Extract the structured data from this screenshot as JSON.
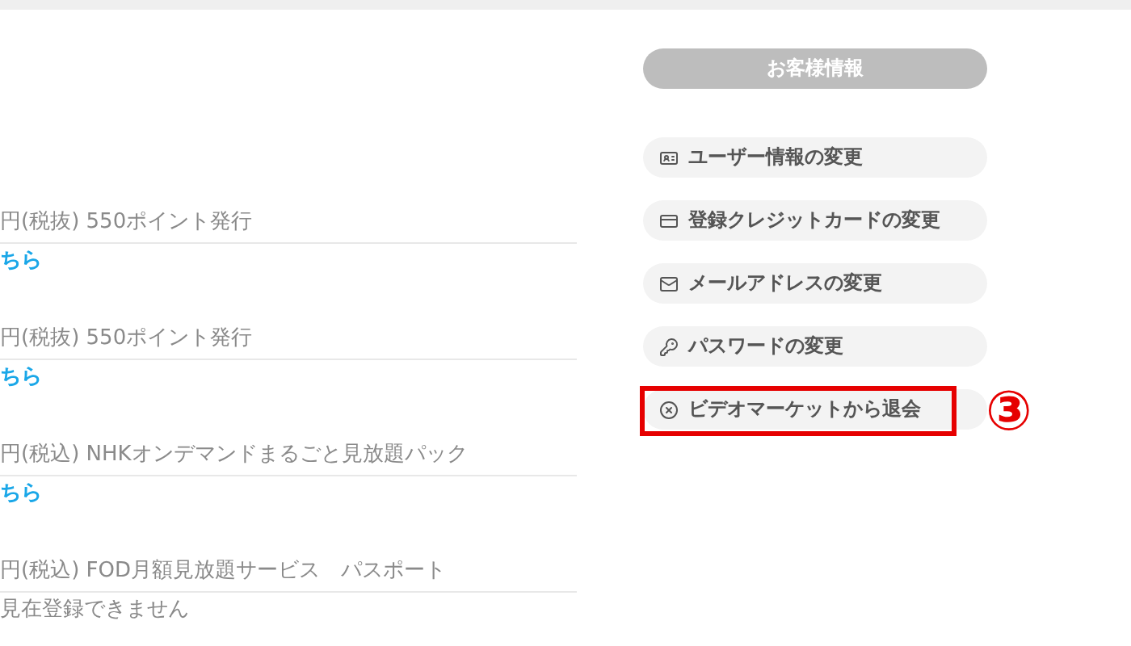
{
  "plans": [
    {
      "description": "円(税抜) 550ポイント発行",
      "action": {
        "kind": "link",
        "text": "ちら"
      }
    },
    {
      "description": "円(税抜) 550ポイント発行",
      "action": {
        "kind": "link",
        "text": "ちら"
      }
    },
    {
      "description": "円(税込) NHKオンデマンドまるごと見放題パック",
      "action": {
        "kind": "link",
        "text": "ちら"
      }
    },
    {
      "description": "円(税込) FOD月額見放題サービス　パスポート",
      "action": {
        "kind": "note",
        "text": "見在登録できません"
      }
    }
  ],
  "customer_menu": {
    "title": "お客様情報",
    "items": [
      {
        "label": "ユーザー情報の変更",
        "highlighted": false
      },
      {
        "label": "登録クレジットカードの変更",
        "highlighted": false
      },
      {
        "label": "メールアドレスの変更",
        "highlighted": false
      },
      {
        "label": "パスワードの変更",
        "highlighted": false
      },
      {
        "label": "ビデオマーケットから退会",
        "highlighted": true
      }
    ]
  },
  "annotation": "③"
}
